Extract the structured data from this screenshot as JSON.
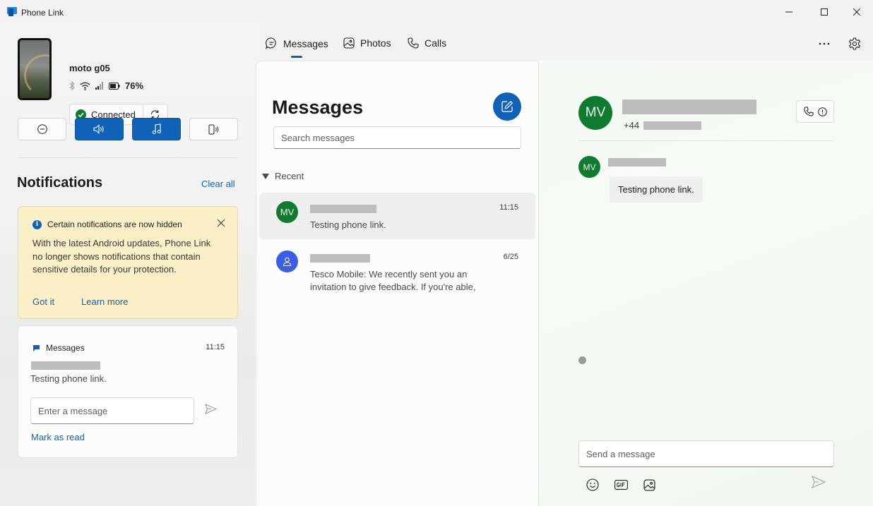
{
  "window": {
    "title": "Phone Link"
  },
  "device": {
    "name": "moto g05",
    "battery": "76%",
    "connection_label": "Connected"
  },
  "notifications": {
    "title": "Notifications",
    "clear_all": "Clear all",
    "banner": {
      "title": "Certain notifications are now hidden",
      "body": "With the latest Android updates, Phone Link no longer shows notifications that contain sensitive details for your protection.",
      "got_it": "Got it",
      "learn_more": "Learn more"
    },
    "message_card": {
      "app": "Messages",
      "time": "11:15",
      "text": "Testing phone link.",
      "input_placeholder": "Enter a message",
      "mark_as_read": "Mark as read"
    }
  },
  "tabs": [
    {
      "label": "Messages",
      "icon": "chat-bubble-icon",
      "selected": true
    },
    {
      "label": "Photos",
      "icon": "photo-icon"
    },
    {
      "label": "Calls",
      "icon": "phone-icon"
    }
  ],
  "messages": {
    "title": "Messages",
    "search_placeholder": "Search messages",
    "recent_label": "Recent",
    "conversations": [
      {
        "initials": "MV",
        "time": "11:15",
        "preview": "Testing phone link."
      },
      {
        "initials": "",
        "time": "6/25",
        "preview": "Tesco Mobile: We recently sent you an invitation to give feedback. If you're able, we'd"
      }
    ]
  },
  "chat": {
    "initials": "MV",
    "phone_prefix": "+44",
    "message_text": "Testing phone link.",
    "input_placeholder": "Send a message"
  },
  "colors": {
    "accent": "#0f62b8",
    "avatar_green": "#0f7b2f",
    "notice_yellow": "#fcf0c8"
  }
}
